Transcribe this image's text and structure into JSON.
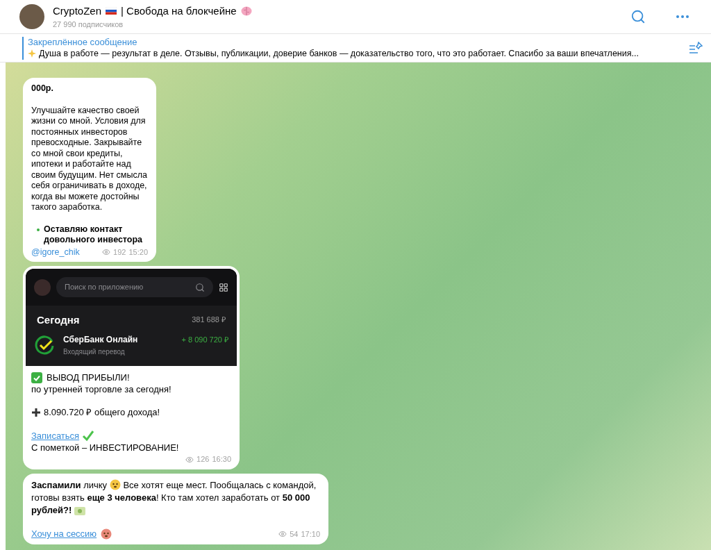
{
  "header": {
    "channel_name": "CryptoZen",
    "channel_tagline": "| Свобода на блокчейне",
    "subscribers": "27 990 подписчиков"
  },
  "pinned": {
    "label": "Закреплённое сообщение",
    "text": "Душа в работе — результат в деле. Отзывы, публикации, доверие банков — доказательство того, что это работает.  Спасибо за ваши впечатления..."
  },
  "messages": [
    {
      "kind": "text",
      "paragraphs": [
        "**000р.**",
        "Улучшайте качество своей жизни со мной. Условия для постоянных инвесторов превосходные. Закрывайте со мной свои кредиты, ипотеки и работайте над своим будущим. Нет смысла себя ограничивать в доходе, когда вы можете достойны такого заработка."
      ],
      "bullet": "Оставляю контакт довольного инвестора",
      "link": "@igore_chik",
      "views": "192",
      "time": "15:20"
    },
    {
      "kind": "photo",
      "app": {
        "search_placeholder": "Поиск по приложению",
        "section": "Сегодня",
        "section_total": "381 688 ₽",
        "bank": "СберБанк Онлайн",
        "operation": "Входящий перевод",
        "amount": "+ 8 090 720 ₽"
      },
      "headline": "ВЫВОД ПРИБЫЛИ!",
      "subline": "по утренней торговле за сегодня!",
      "income": "8.090.720 ₽ общего дохода!",
      "link": "Записаться",
      "note": "С пометкой – ИНВЕСТИРОВАНИЕ!",
      "views": "126",
      "time": "16:30"
    },
    {
      "kind": "text_link",
      "text": "**Заспамили** личку",
      "text_after": "Все хотят еще мест. Пообщалась с командой, готовы взять **еще 3 человека**! Кто там хотел заработать от **50 000 рублей?!**",
      "link": "Хочу на сессию",
      "views": "54",
      "time": "17:10"
    }
  ]
}
